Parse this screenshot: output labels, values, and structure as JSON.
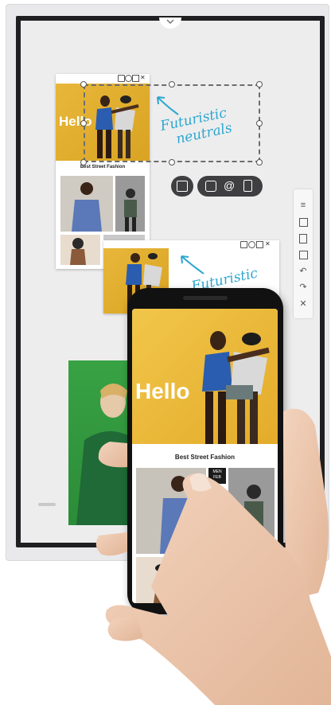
{
  "board": {
    "card": {
      "hello": "Hello",
      "caption": "Best Street Fashion"
    },
    "annotation": {
      "line1": "Futuristic",
      "line2": "neutrals"
    },
    "mirror": {
      "annotation": "Futuristic"
    },
    "controls": {
      "icons": [
        "resize-icon",
        "camera-icon",
        "at-icon",
        "document-icon"
      ]
    },
    "toolbar": {
      "icons": [
        "menu-icon",
        "sticky-note-icon",
        "clipboard-icon",
        "select-rect-icon",
        "undo-icon",
        "redo-icon",
        "close-icon"
      ]
    }
  },
  "phone": {
    "hello": "Hello",
    "caption": "Best Street Fashion",
    "badge_line1": "MEN",
    "badge_line2": "FEB"
  },
  "colors": {
    "accent": "#2ca7cf",
    "hero_yellow": "#e8b73a",
    "bezel": "#1f1f21",
    "board_bg": "#ededee",
    "pill": "#3f3f42"
  }
}
